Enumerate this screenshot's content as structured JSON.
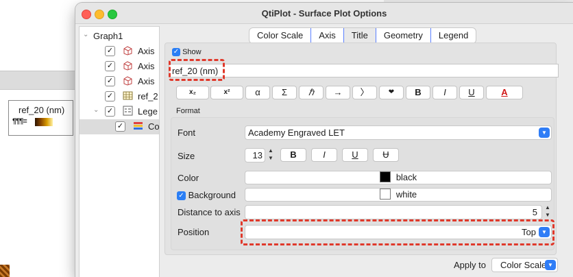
{
  "background": {
    "legend_title": "ref_20 (nm)",
    "legend_glyph": "¶¶¶≡",
    "gradient_colors": [
      "#2a1400",
      "#8a4600",
      "#d89a00",
      "#fff2a8"
    ]
  },
  "window": {
    "title": "QtiPlot - Surface Plot Options"
  },
  "tree": {
    "root": "Graph1",
    "items": [
      {
        "label": "Axis",
        "icon": "axis-cube-icon",
        "checked": true
      },
      {
        "label": "Axis",
        "icon": "axis-cube-icon",
        "checked": true
      },
      {
        "label": "Axis",
        "icon": "axis-cube-icon",
        "checked": true
      },
      {
        "label": "ref_2",
        "icon": "grid-table-icon",
        "checked": true
      },
      {
        "label": "Lege",
        "icon": "legend-icon",
        "checked": true
      },
      {
        "label": "Co",
        "icon": "color-scale-icon",
        "checked": true
      }
    ]
  },
  "tabs": [
    "Color Scale",
    "Axis",
    "Title",
    "Geometry",
    "Legend"
  ],
  "active_tab": "Title",
  "title_tab": {
    "show_label": "Show",
    "show_checked": true,
    "text_value": "ref_20 (nm)",
    "format_buttons": [
      "x₂",
      "x²",
      "α",
      "Σ",
      "ℏ",
      "→",
      "〉",
      "❤",
      "B",
      "I",
      "U",
      "A"
    ],
    "format_section": "Format",
    "font_label": "Font",
    "font_value": "Academy Engraved LET",
    "size_label": "Size",
    "size_value": "13",
    "style_buttons": [
      "B",
      "I",
      "U",
      "Ʉ"
    ],
    "color_label": "Color",
    "color_name": "black",
    "color_hex": "#000000",
    "background_label": "Background",
    "background_checked": true,
    "background_name": "white",
    "background_hex": "#ffffff",
    "distance_label": "Distance to axis",
    "distance_value": "5",
    "position_label": "Position",
    "position_value": "Top"
  },
  "footer": {
    "apply_to_label": "Apply to",
    "apply_to_value": "Color Scale"
  },
  "accent_color": "#2f7df6",
  "highlight_color": "#e0392b"
}
